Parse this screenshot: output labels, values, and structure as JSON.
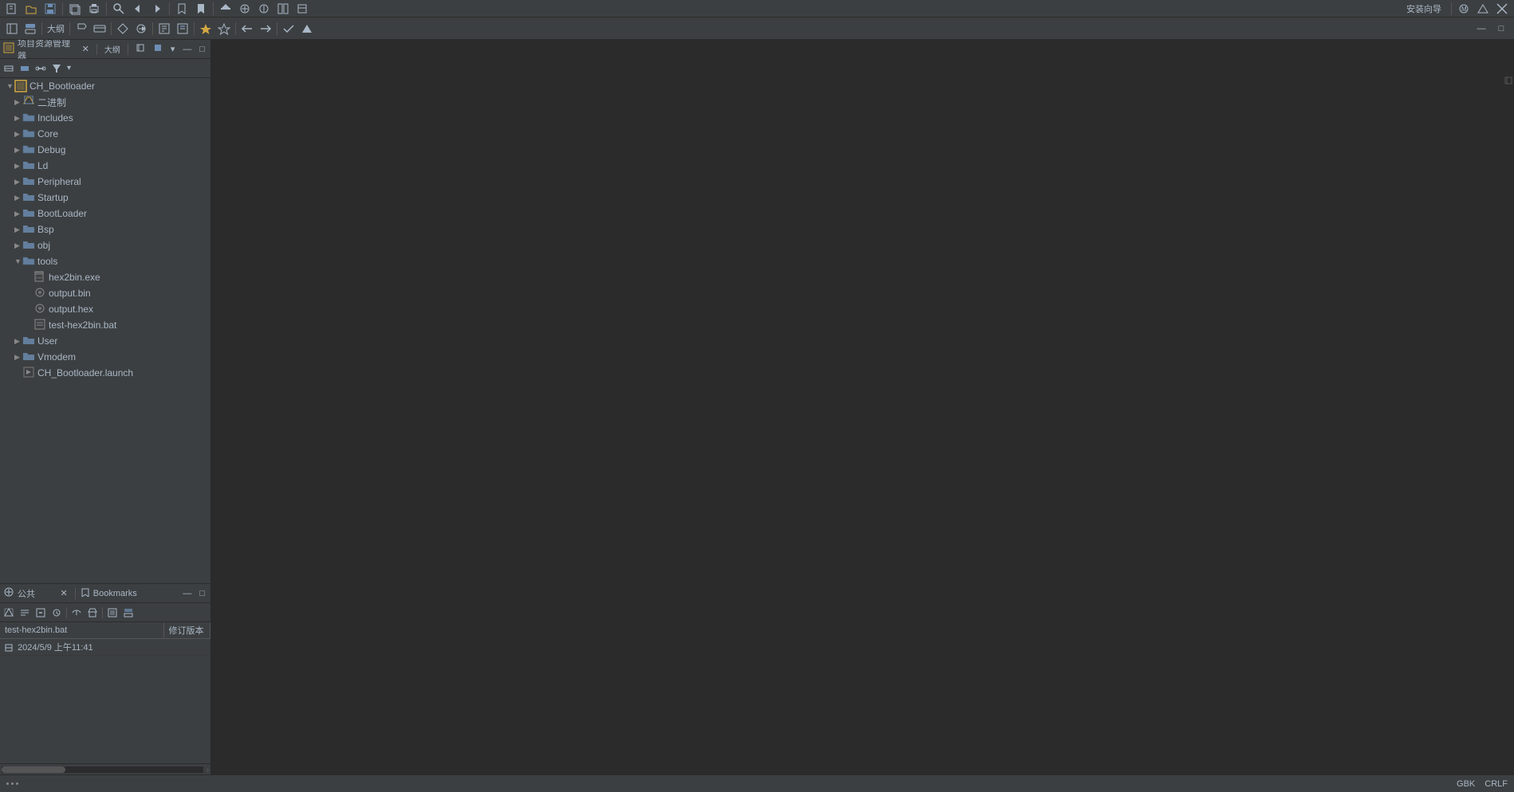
{
  "app": {
    "title": "CH_Bootloader",
    "encoding": "GBK",
    "line_ending": "CRLF"
  },
  "top_toolbar": {
    "buttons": [
      "⊞",
      "💾",
      "🔄",
      "⬛",
      "📁",
      "⬛",
      "⬛",
      "⬛",
      "⬛",
      "⬛",
      "⬛",
      "⬛",
      "⬛",
      "⬛",
      "⬛",
      "⬛",
      "⬛",
      "⬛",
      "⬛",
      "⬛",
      "⬛",
      "⬛",
      "⬛"
    ],
    "right_label": "安装向导"
  },
  "project_panel": {
    "title": "项目资源管理器",
    "toolbar_buttons": [
      "大纲",
      "⬛",
      "⬛",
      "⬛",
      "⬛",
      "⬛"
    ],
    "tree": {
      "root": {
        "label": "CH_Bootloader",
        "expanded": true,
        "children": [
          {
            "label": "二进制",
            "icon": "folder-special",
            "expanded": false,
            "children": []
          },
          {
            "label": "Includes",
            "icon": "folder-blue",
            "expanded": false,
            "children": []
          },
          {
            "label": "Core",
            "icon": "folder-blue",
            "expanded": false,
            "children": []
          },
          {
            "label": "Debug",
            "icon": "folder-blue",
            "expanded": false,
            "children": []
          },
          {
            "label": "Ld",
            "icon": "folder-blue",
            "expanded": false,
            "children": []
          },
          {
            "label": "Peripheral",
            "icon": "folder-blue",
            "expanded": false,
            "children": []
          },
          {
            "label": "Startup",
            "icon": "folder-blue",
            "expanded": false,
            "children": []
          },
          {
            "label": "BootLoader",
            "icon": "folder-blue",
            "expanded": false,
            "children": []
          },
          {
            "label": "Bsp",
            "icon": "folder-blue",
            "expanded": false,
            "children": []
          },
          {
            "label": "obj",
            "icon": "folder-blue",
            "expanded": false,
            "children": []
          },
          {
            "label": "tools",
            "icon": "folder-blue",
            "expanded": true,
            "children": [
              {
                "label": "hex2bin.exe",
                "icon": "file-exe"
              },
              {
                "label": "output.bin",
                "icon": "file-bin"
              },
              {
                "label": "output.hex",
                "icon": "file-hex"
              },
              {
                "label": "test-hex2bin.bat",
                "icon": "file-bat",
                "selected": false
              }
            ]
          },
          {
            "label": "User",
            "icon": "folder-blue",
            "expanded": false,
            "children": []
          },
          {
            "label": "Vmodem",
            "icon": "folder-blue",
            "expanded": false,
            "children": []
          },
          {
            "label": "CH_Bootloader.launch",
            "icon": "file-launch"
          }
        ]
      }
    }
  },
  "bookmarks_panel": {
    "title": "公共",
    "tab": "Bookmarks",
    "columns": [
      {
        "label": "修订版本"
      }
    ],
    "rows": [
      {
        "file": "test-hex2bin.bat",
        "col": "修订版本",
        "date": "2024/5/9 上午11:41"
      }
    ]
  },
  "status_bar": {
    "encoding": "GBK",
    "line_ending": "CRLF"
  }
}
